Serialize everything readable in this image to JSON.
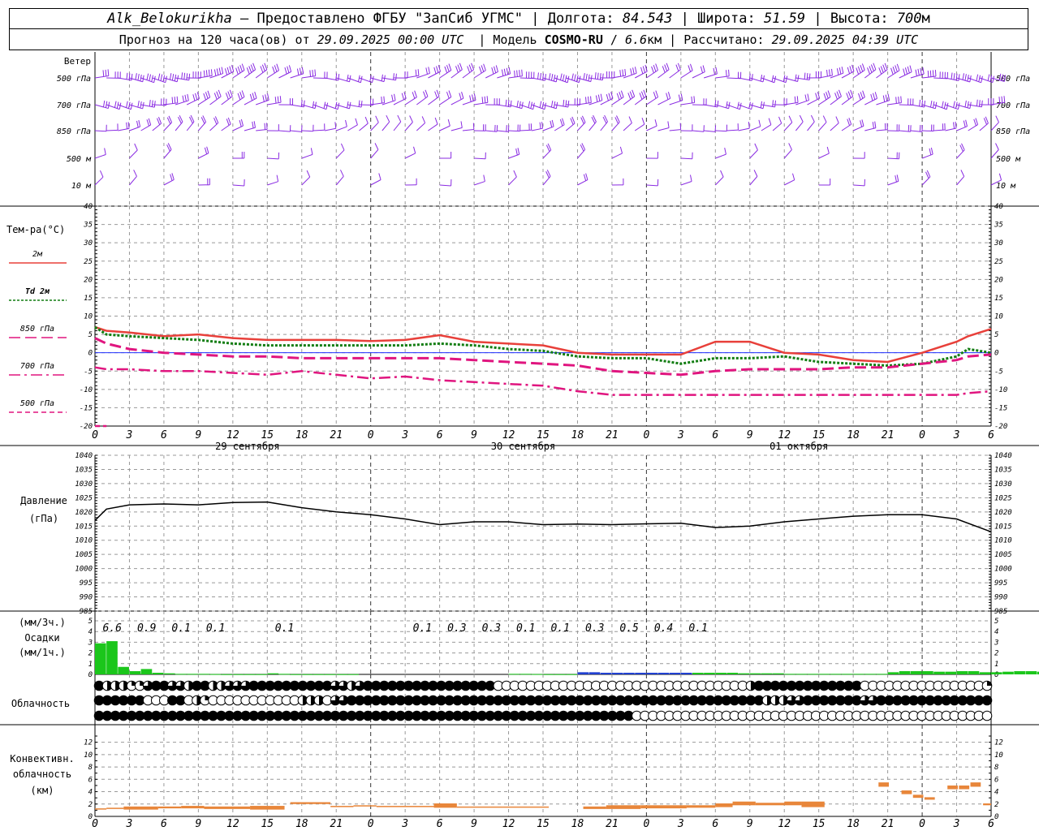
{
  "header": {
    "station": "Alk_Belokurikha",
    "dash": "–",
    "provided_by": "Предоставлено ФГБУ \"ЗапСиб УГМС\"",
    "sep": "|",
    "lon_label": "Долгота:",
    "lon_value": "84.543",
    "lat_label": "Широта:",
    "lat_value": "51.59",
    "alt_label": "Высота:",
    "alt_value": "700",
    "alt_unit": "м",
    "forecast_label": "Прогноз на 120 часа(ов) от",
    "forecast_start": "29.09.2025 00:00 UTC",
    "model_label": "Модель",
    "model_name": "COSMO-RU",
    "model_slash": "/",
    "model_res": "6.6",
    "model_res_unit": "км",
    "calc_label": "Рассчитано:",
    "calc_time": "29.09.2025 04:39 UTC"
  },
  "colors": {
    "wind": "#8a2be2",
    "t2m": "#e8403a",
    "td2m": "#127d12",
    "t850": "#e0157f",
    "t700": "#e0157f",
    "t500": "#e0157f",
    "pressure": "#000000",
    "precip_rain": "#1bc61b",
    "precip_snow": "#1f3fd0",
    "convective": "#e8863a",
    "zero_line": "#2030ff",
    "grid": "#999999"
  },
  "time_axis": {
    "tick_hours": [
      "0",
      "3",
      "6",
      "9",
      "12",
      "15",
      "18",
      "21",
      "0",
      "3",
      "6",
      "9",
      "12",
      "15",
      "18",
      "21",
      "0",
      "3",
      "6",
      "9",
      "12",
      "15",
      "18",
      "21",
      "0",
      "3",
      "6"
    ],
    "day_labels": [
      "29 сентября",
      "30 сентября",
      "01 октября"
    ]
  },
  "wind_panel": {
    "title": "Ветер",
    "levels": [
      "500 гПа",
      "700 гПа",
      "850 гПа",
      "500 м",
      "10  м"
    ]
  },
  "chart_data": [
    {
      "type": "line",
      "title": "Тем-ра(°C)",
      "x_unit": "hours from 29.09.2025 00:00 UTC",
      "xlim": [
        0,
        78
      ],
      "ylim": [
        -20,
        40
      ],
      "y_ticks": [
        "-20",
        "-15",
        "-10",
        "-5",
        "0",
        "5",
        "10",
        "15",
        "20",
        "25",
        "30",
        "35",
        "40"
      ],
      "x": [
        0,
        1,
        3,
        6,
        9,
        12,
        15,
        18,
        21,
        24,
        27,
        30,
        33,
        36,
        39,
        42,
        45,
        48,
        51,
        54,
        57,
        60,
        63,
        66,
        69,
        72,
        75,
        76,
        78
      ],
      "series": [
        {
          "name": "2м",
          "style": "solid",
          "values": [
            7,
            6,
            5.5,
            4.5,
            5,
            4,
            3.5,
            3.5,
            3.5,
            3.2,
            3.5,
            4.8,
            3,
            2.5,
            2,
            0,
            -0.5,
            -0.5,
            -0.5,
            3,
            3,
            0,
            -0.5,
            -2,
            -2.5,
            0,
            3,
            4.5,
            6.5
          ]
        },
        {
          "name": "Td 2м",
          "style": "dotted",
          "values": [
            7,
            5,
            4.5,
            4,
            3.5,
            2.5,
            2,
            2,
            2,
            2,
            2,
            2.5,
            2,
            1,
            0.5,
            -1,
            -1.5,
            -1.5,
            -3,
            -1.5,
            -1.5,
            -1,
            -2.5,
            -3,
            -3.5,
            -3,
            -1,
            1,
            0
          ]
        },
        {
          "name": "850 гПа",
          "style": "dash",
          "values": [
            4,
            2.5,
            1,
            0,
            -0.5,
            -1,
            -1,
            -1.5,
            -1.5,
            -1.5,
            -1.5,
            -1.5,
            -2,
            -2.5,
            -3,
            -3.5,
            -5,
            -5.5,
            -6,
            -5,
            -4.5,
            -4.5,
            -4.5,
            -4,
            -4,
            -3,
            -2,
            -1,
            -0.5
          ]
        },
        {
          "name": "700 гПа",
          "style": "dashdot",
          "values": [
            -4,
            -4.5,
            -4.5,
            -5,
            -5,
            -5.5,
            -6,
            -5,
            -6,
            -7,
            -6.5,
            -7.5,
            -8,
            -8.5,
            -9,
            -10.5,
            -11.5,
            -11.5,
            -11.5,
            -11.5,
            -11.5,
            -11.5,
            -11.5,
            -11.5,
            -11.5,
            -11.5,
            -11.5,
            -11,
            -10.5
          ]
        },
        {
          "name": "500 гПа",
          "style": "shortdash",
          "values": [
            -20,
            -20,
            null,
            null,
            null,
            null,
            null,
            null,
            null,
            null,
            null,
            null,
            null,
            null,
            null,
            null,
            null,
            null,
            null,
            null,
            null,
            null,
            null,
            null,
            null,
            null,
            null,
            null,
            null
          ]
        }
      ]
    },
    {
      "type": "line",
      "title": "Давление",
      "ylabel": "(гПа)",
      "ylim": [
        985,
        1040
      ],
      "y_ticks": [
        "985",
        "990",
        "995",
        "1000",
        "1005",
        "1010",
        "1015",
        "1020",
        "1025",
        "1030",
        "1035",
        "1040"
      ],
      "x": [
        0,
        1,
        3,
        6,
        9,
        12,
        15,
        18,
        21,
        24,
        27,
        30,
        33,
        36,
        39,
        42,
        45,
        48,
        51,
        54,
        57,
        60,
        63,
        66,
        69,
        72,
        75,
        78
      ],
      "series": [
        {
          "name": "pressure",
          "values": [
            1017,
            1021,
            1022.5,
            1022.8,
            1022.5,
            1023.3,
            1023.5,
            1021.5,
            1020,
            1019,
            1017.5,
            1015.5,
            1016.5,
            1016.5,
            1015.5,
            1015.7,
            1015.5,
            1015.8,
            1016,
            1014.5,
            1015,
            1016.5,
            1017.5,
            1018.5,
            1019,
            1019,
            1017.5,
            1013
          ]
        }
      ]
    },
    {
      "type": "bar",
      "title": "Осадки",
      "ylabel_1": "(мм/3ч.)",
      "ylabel_2": "(мм/1ч.)",
      "ylim": [
        0,
        5
      ],
      "y_ticks": [
        "0",
        "1",
        "2",
        "3",
        "4",
        "5"
      ],
      "hour_values": [
        2.9,
        3.1,
        0.7,
        0.3,
        0.5,
        0.15,
        0.1,
        0.05,
        0.05,
        0.05,
        0.03,
        0.02,
        0.02,
        0.02,
        0.02,
        0.1,
        0.05,
        0.02,
        0.02,
        0.02,
        0.02,
        0.02,
        0.02,
        0,
        0,
        0,
        0,
        0,
        0,
        0,
        0,
        0,
        0,
        0,
        0,
        0,
        0.05,
        0.05,
        0.03,
        0.02,
        0.02,
        0.02,
        0.2,
        0.2,
        0.15,
        0.15,
        0.15,
        0.15,
        0.15,
        0.15,
        0.15,
        0.15,
        0.15,
        0.15,
        0.15,
        0.15,
        0.1,
        0.1,
        0.1,
        0.1,
        0.05,
        0.05,
        0.05,
        0.05,
        0.05,
        0.05,
        0.05,
        0.05,
        0.05,
        0.2,
        0.3,
        0.3,
        0.3,
        0.25,
        0.25,
        0.3,
        0.3,
        0.2,
        0.2,
        0.25,
        0.3,
        0.3,
        0.25,
        0.2,
        0.15,
        0.15,
        0.05,
        0.03,
        0.02,
        0.02
      ],
      "snow_range": [
        42,
        52
      ],
      "labels": [
        {
          "x": 1.5,
          "text": "6.6"
        },
        {
          "x": 4.5,
          "text": "0.9"
        },
        {
          "x": 7.5,
          "text": "0.1"
        },
        {
          "x": 10.5,
          "text": "0.1"
        },
        {
          "x": 16.5,
          "text": "0.1"
        },
        {
          "x": 28.5,
          "text": "0.1"
        },
        {
          "x": 31.5,
          "text": "0.3"
        },
        {
          "x": 34.5,
          "text": "0.3"
        },
        {
          "x": 37.5,
          "text": "0.1"
        },
        {
          "x": 40.5,
          "text": "0.1"
        },
        {
          "x": 43.5,
          "text": "0.3"
        },
        {
          "x": 46.5,
          "text": "0.5"
        },
        {
          "x": 49.5,
          "text": "0.4"
        },
        {
          "x": 52.5,
          "text": "0.1"
        }
      ]
    },
    {
      "type": "table",
      "title": "Облачность",
      "legend": "0=clear,1=quarter,2=half,3=three-quarter,4=overcast",
      "rows": [
        "42221134433244223334444444444332344444444444444440000000000000000000000000000000244444444444440000000000000001",
        "44444400044021000000000002220334444444444444444444444444444444444444444444444444442223344444443344444444444444",
        "44444444444444444444444444444444444444444444444444444444444444444400000000000000000000000000000000000000000000"
      ]
    },
    {
      "type": "bar",
      "title": "Конвективн.",
      "subtitle": "облачность",
      "ylabel": "(км)",
      "ylim": [
        0,
        13
      ],
      "y_ticks": [
        "0",
        "2",
        "4",
        "6",
        "8",
        "10",
        "12"
      ],
      "segments": [
        {
          "x0": 0,
          "x1": 1,
          "base": 1.1,
          "top": 1.3
        },
        {
          "x0": 1,
          "x1": 2.5,
          "base": 1.2,
          "top": 1.4
        },
        {
          "x0": 2.5,
          "x1": 5.5,
          "base": 1.1,
          "top": 1.6
        },
        {
          "x0": 5.5,
          "x1": 7.5,
          "base": 1.3,
          "top": 1.6
        },
        {
          "x0": 7.5,
          "x1": 9.5,
          "base": 1.3,
          "top": 1.7
        },
        {
          "x0": 9.5,
          "x1": 13.5,
          "base": 1.2,
          "top": 1.6
        },
        {
          "x0": 13.5,
          "x1": 16.5,
          "base": 1.1,
          "top": 1.7
        },
        {
          "x0": 17,
          "x1": 20.5,
          "base": 2.0,
          "top": 2.3
        },
        {
          "x0": 20.5,
          "x1": 22.5,
          "base": 1.5,
          "top": 1.7
        },
        {
          "x0": 22.5,
          "x1": 24.5,
          "base": 1.6,
          "top": 1.8
        },
        {
          "x0": 24.5,
          "x1": 29.5,
          "base": 1.5,
          "top": 1.7
        },
        {
          "x0": 29.5,
          "x1": 31.5,
          "base": 1.4,
          "top": 2.1
        },
        {
          "x0": 31.5,
          "x1": 35.5,
          "base": 1.4,
          "top": 1.6
        },
        {
          "x0": 35.5,
          "x1": 39.5,
          "base": 1.4,
          "top": 1.6
        },
        {
          "x0": 42.5,
          "x1": 44.5,
          "base": 1.2,
          "top": 1.6
        },
        {
          "x0": 44.5,
          "x1": 47.5,
          "base": 1.2,
          "top": 1.8
        },
        {
          "x0": 47.5,
          "x1": 51.5,
          "base": 1.3,
          "top": 1.8
        },
        {
          "x0": 51.5,
          "x1": 54,
          "base": 1.4,
          "top": 1.8
        },
        {
          "x0": 54,
          "x1": 55.5,
          "base": 1.5,
          "top": 2.1
        },
        {
          "x0": 55.5,
          "x1": 57.5,
          "base": 1.8,
          "top": 2.4
        },
        {
          "x0": 57.5,
          "x1": 60,
          "base": 1.8,
          "top": 2.2
        },
        {
          "x0": 60,
          "x1": 61.5,
          "base": 1.8,
          "top": 2.4
        },
        {
          "x0": 61.5,
          "x1": 63.5,
          "base": 1.5,
          "top": 2.4
        },
        {
          "x0": 68.2,
          "x1": 69.1,
          "base": 4.8,
          "top": 5.5
        },
        {
          "x0": 70.2,
          "x1": 71.1,
          "base": 3.6,
          "top": 4.2
        },
        {
          "x0": 71.2,
          "x1": 72.1,
          "base": 3.0,
          "top": 3.5
        },
        {
          "x0": 72.2,
          "x1": 73.1,
          "base": 2.7,
          "top": 3.1
        },
        {
          "x0": 74.2,
          "x1": 75.1,
          "base": 4.4,
          "top": 5.0
        },
        {
          "x0": 75.2,
          "x1": 76.1,
          "base": 4.4,
          "top": 5.0
        },
        {
          "x0": 76.2,
          "x1": 77.1,
          "base": 4.8,
          "top": 5.5
        },
        {
          "x0": 77.3,
          "x1": 78,
          "base": 1.8,
          "top": 2.1
        }
      ]
    }
  ]
}
